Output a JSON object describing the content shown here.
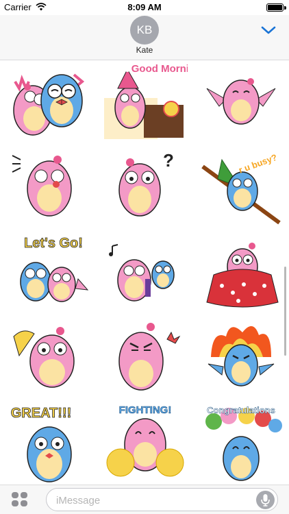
{
  "status_bar": {
    "carrier": "Carrier",
    "time": "8:09 AM",
    "battery_level": 1.0
  },
  "header": {
    "avatar_initials": "KB",
    "contact_name": "Kate",
    "collapse_icon": "chevron-down-icon"
  },
  "stickers": [
    {
      "name": "owl-couple-love",
      "caption": ""
    },
    {
      "name": "owl-good-morning",
      "caption": "Good Morning"
    },
    {
      "name": "owl-wings-spread",
      "caption": ""
    },
    {
      "name": "owl-eating",
      "caption": ""
    },
    {
      "name": "owl-question",
      "caption": "?"
    },
    {
      "name": "owl-u-busy",
      "caption": "r u busy?"
    },
    {
      "name": "owl-lets-go",
      "caption": "Let's Go!"
    },
    {
      "name": "owl-music",
      "caption": ""
    },
    {
      "name": "owl-blanket",
      "caption": ""
    },
    {
      "name": "owl-fan",
      "caption": ""
    },
    {
      "name": "owl-angry",
      "caption": ""
    },
    {
      "name": "owl-fire",
      "caption": ""
    },
    {
      "name": "owl-great",
      "caption": "GREAT!!!"
    },
    {
      "name": "owl-fighting",
      "caption": "FIGHTING!"
    },
    {
      "name": "owl-congratulations",
      "caption": "Congratulations"
    }
  ],
  "composer": {
    "apps_icon": "app-drawer-icon",
    "placeholder": "iMessage",
    "mic_icon": "microphone-icon"
  },
  "colors": {
    "accent": "#1a74d6",
    "owl_pink": "#f39ac6",
    "owl_blue": "#5fa9e6",
    "owl_belly": "#fbe3a3"
  }
}
